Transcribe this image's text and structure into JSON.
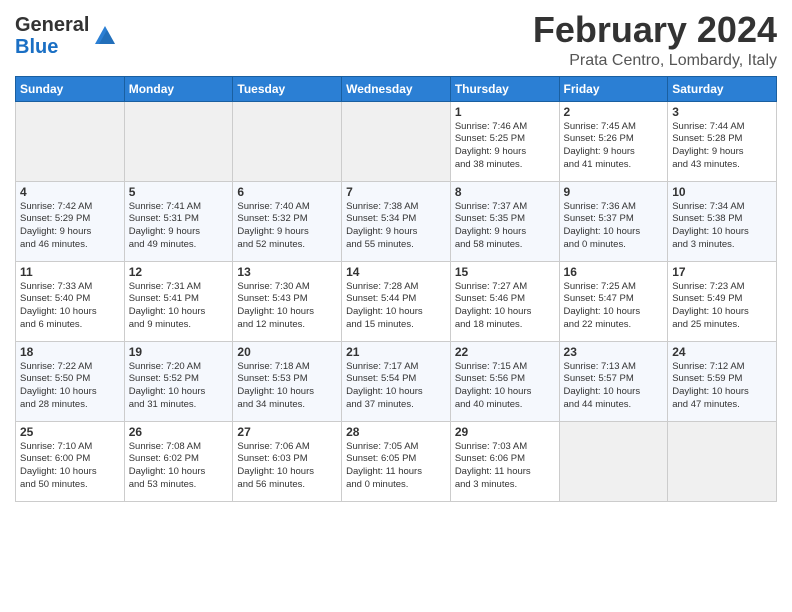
{
  "header": {
    "logo_general": "General",
    "logo_blue": "Blue",
    "month": "February 2024",
    "location": "Prata Centro, Lombardy, Italy"
  },
  "weekdays": [
    "Sunday",
    "Monday",
    "Tuesday",
    "Wednesday",
    "Thursday",
    "Friday",
    "Saturday"
  ],
  "weeks": [
    [
      {
        "day": "",
        "info": ""
      },
      {
        "day": "",
        "info": ""
      },
      {
        "day": "",
        "info": ""
      },
      {
        "day": "",
        "info": ""
      },
      {
        "day": "1",
        "info": "Sunrise: 7:46 AM\nSunset: 5:25 PM\nDaylight: 9 hours\nand 38 minutes."
      },
      {
        "day": "2",
        "info": "Sunrise: 7:45 AM\nSunset: 5:26 PM\nDaylight: 9 hours\nand 41 minutes."
      },
      {
        "day": "3",
        "info": "Sunrise: 7:44 AM\nSunset: 5:28 PM\nDaylight: 9 hours\nand 43 minutes."
      }
    ],
    [
      {
        "day": "4",
        "info": "Sunrise: 7:42 AM\nSunset: 5:29 PM\nDaylight: 9 hours\nand 46 minutes."
      },
      {
        "day": "5",
        "info": "Sunrise: 7:41 AM\nSunset: 5:31 PM\nDaylight: 9 hours\nand 49 minutes."
      },
      {
        "day": "6",
        "info": "Sunrise: 7:40 AM\nSunset: 5:32 PM\nDaylight: 9 hours\nand 52 minutes."
      },
      {
        "day": "7",
        "info": "Sunrise: 7:38 AM\nSunset: 5:34 PM\nDaylight: 9 hours\nand 55 minutes."
      },
      {
        "day": "8",
        "info": "Sunrise: 7:37 AM\nSunset: 5:35 PM\nDaylight: 9 hours\nand 58 minutes."
      },
      {
        "day": "9",
        "info": "Sunrise: 7:36 AM\nSunset: 5:37 PM\nDaylight: 10 hours\nand 0 minutes."
      },
      {
        "day": "10",
        "info": "Sunrise: 7:34 AM\nSunset: 5:38 PM\nDaylight: 10 hours\nand 3 minutes."
      }
    ],
    [
      {
        "day": "11",
        "info": "Sunrise: 7:33 AM\nSunset: 5:40 PM\nDaylight: 10 hours\nand 6 minutes."
      },
      {
        "day": "12",
        "info": "Sunrise: 7:31 AM\nSunset: 5:41 PM\nDaylight: 10 hours\nand 9 minutes."
      },
      {
        "day": "13",
        "info": "Sunrise: 7:30 AM\nSunset: 5:43 PM\nDaylight: 10 hours\nand 12 minutes."
      },
      {
        "day": "14",
        "info": "Sunrise: 7:28 AM\nSunset: 5:44 PM\nDaylight: 10 hours\nand 15 minutes."
      },
      {
        "day": "15",
        "info": "Sunrise: 7:27 AM\nSunset: 5:46 PM\nDaylight: 10 hours\nand 18 minutes."
      },
      {
        "day": "16",
        "info": "Sunrise: 7:25 AM\nSunset: 5:47 PM\nDaylight: 10 hours\nand 22 minutes."
      },
      {
        "day": "17",
        "info": "Sunrise: 7:23 AM\nSunset: 5:49 PM\nDaylight: 10 hours\nand 25 minutes."
      }
    ],
    [
      {
        "day": "18",
        "info": "Sunrise: 7:22 AM\nSunset: 5:50 PM\nDaylight: 10 hours\nand 28 minutes."
      },
      {
        "day": "19",
        "info": "Sunrise: 7:20 AM\nSunset: 5:52 PM\nDaylight: 10 hours\nand 31 minutes."
      },
      {
        "day": "20",
        "info": "Sunrise: 7:18 AM\nSunset: 5:53 PM\nDaylight: 10 hours\nand 34 minutes."
      },
      {
        "day": "21",
        "info": "Sunrise: 7:17 AM\nSunset: 5:54 PM\nDaylight: 10 hours\nand 37 minutes."
      },
      {
        "day": "22",
        "info": "Sunrise: 7:15 AM\nSunset: 5:56 PM\nDaylight: 10 hours\nand 40 minutes."
      },
      {
        "day": "23",
        "info": "Sunrise: 7:13 AM\nSunset: 5:57 PM\nDaylight: 10 hours\nand 44 minutes."
      },
      {
        "day": "24",
        "info": "Sunrise: 7:12 AM\nSunset: 5:59 PM\nDaylight: 10 hours\nand 47 minutes."
      }
    ],
    [
      {
        "day": "25",
        "info": "Sunrise: 7:10 AM\nSunset: 6:00 PM\nDaylight: 10 hours\nand 50 minutes."
      },
      {
        "day": "26",
        "info": "Sunrise: 7:08 AM\nSunset: 6:02 PM\nDaylight: 10 hours\nand 53 minutes."
      },
      {
        "day": "27",
        "info": "Sunrise: 7:06 AM\nSunset: 6:03 PM\nDaylight: 10 hours\nand 56 minutes."
      },
      {
        "day": "28",
        "info": "Sunrise: 7:05 AM\nSunset: 6:05 PM\nDaylight: 11 hours\nand 0 minutes."
      },
      {
        "day": "29",
        "info": "Sunrise: 7:03 AM\nSunset: 6:06 PM\nDaylight: 11 hours\nand 3 minutes."
      },
      {
        "day": "",
        "info": ""
      },
      {
        "day": "",
        "info": ""
      }
    ]
  ]
}
